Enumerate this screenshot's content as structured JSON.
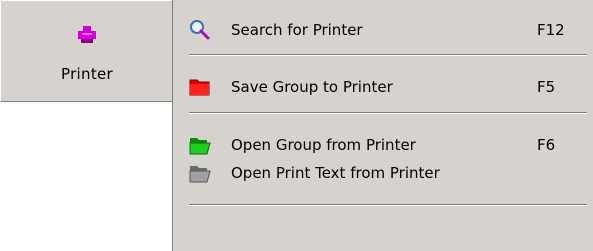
{
  "printer_button": {
    "label": "Printer",
    "icon": "printer-icon"
  },
  "menu": {
    "items": [
      {
        "label": "Search for Printer",
        "shortcut": "F12",
        "icon": "magnifier-icon"
      },
      {
        "label": "Save Group to Printer",
        "shortcut": "F5",
        "icon": "red-folder-icon"
      },
      {
        "label": "Open Group from Printer",
        "shortcut": "F6",
        "icon": "green-folder-icon"
      },
      {
        "label": "Open Print Text from Printer",
        "shortcut": "",
        "icon": "gray-folder-icon"
      }
    ]
  },
  "colors": {
    "panel_bg": "#d6d3ce",
    "printer_icon": "#d400d4",
    "red_folder": "#e60000",
    "green_folder": "#10c010",
    "gray_folder": "#8c8c8c"
  }
}
